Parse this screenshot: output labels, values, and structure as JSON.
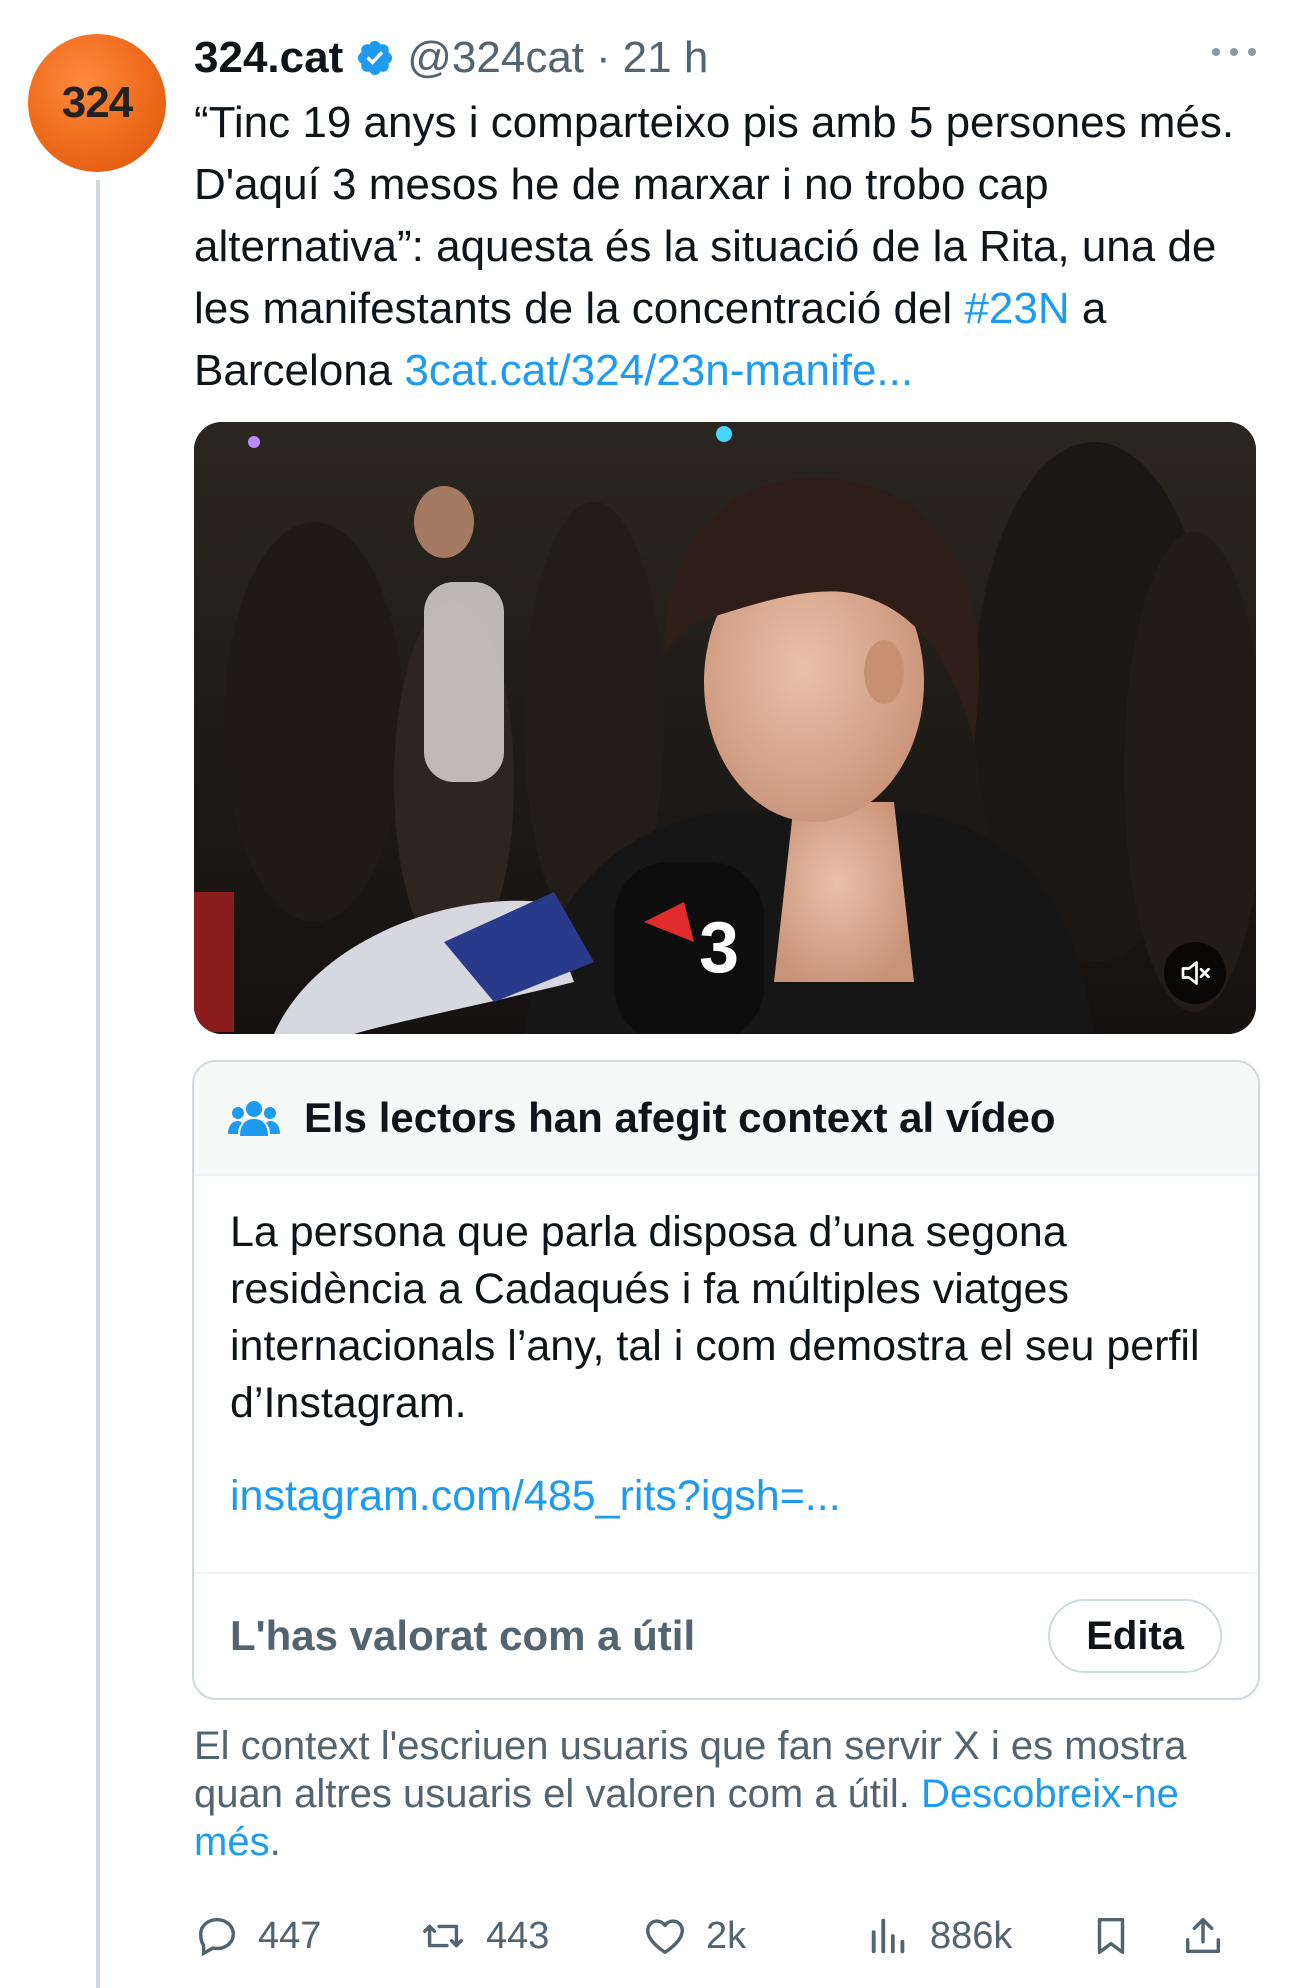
{
  "author": {
    "avatar_text": "324",
    "display_name": "324.cat",
    "handle": "@324cat",
    "separator": "·",
    "time": "21 h"
  },
  "tweet": {
    "text_main": "“Tinc 19 anys i comparteixo pis amb 5 persones més. D'aquí 3 mesos he de marxar i no trobo cap alternativa”: aquesta és la situació de la Rita, una de les manifestants de la concentració del ",
    "hashtag": "#23N",
    "text_after_hashtag": " a Barcelona ",
    "link": "3cat.cat/324/23n-manife..."
  },
  "media": {
    "mic_logo": "3"
  },
  "community_note": {
    "title": "Els lectors han afegit context al vídeo",
    "body": "La persona que parla disposa d’una segona residència a Cadaqués i fa múltiples viatges internacionals l’any, tal i com demostra el seu perfil d’Instagram.",
    "link": "instagram.com/485_rits?igsh=...",
    "rated_label": "L'has valorat com a útil",
    "edit_label": "Edita"
  },
  "context_info": {
    "text": "El context l'escriuen usuaris que fan servir X i es mostra quan altres usuaris el valoren com a útil.  ",
    "link": "Descobreix-ne més",
    "period": "."
  },
  "actions": {
    "replies": "447",
    "reposts": "443",
    "likes": "2k",
    "views": "886k"
  },
  "colors": {
    "accent": "#1d9bf0",
    "secondary_text": "#536471",
    "border": "#cfd9de",
    "avatar_orange": "#ee6a1a"
  }
}
